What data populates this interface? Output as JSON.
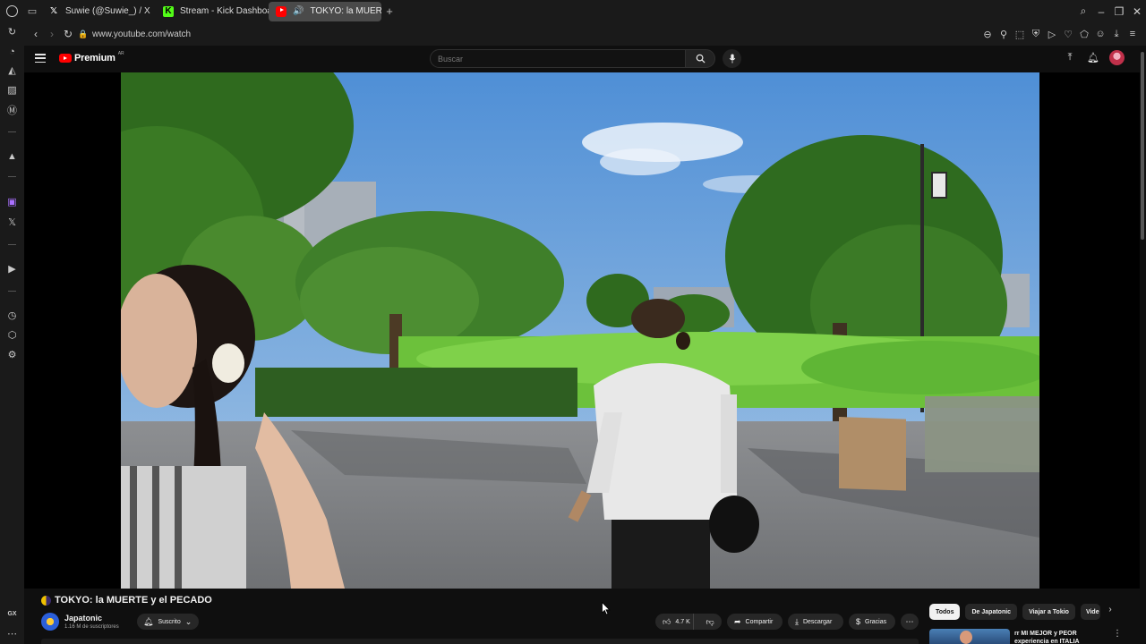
{
  "browser": {
    "tabs": [
      {
        "title": "Suwie (@Suwie_) / X",
        "icon": "x-logo-icon",
        "active": false
      },
      {
        "title": "Stream - Kick Dashboard",
        "icon": "kick-logo-icon",
        "active": false
      },
      {
        "title": "TOKYO: la MUERTE",
        "icon": "youtube-logo-icon",
        "active": true,
        "audio": true
      }
    ],
    "url": "www.youtube.com/watch",
    "sidebar_bottom_label": "GX"
  },
  "youtube": {
    "logo_text": "Premium",
    "logo_superscript": "AR",
    "search_placeholder": "Buscar",
    "accent": "#ff0000"
  },
  "video": {
    "title_emoji": "🌓",
    "title": "TOKYO: la MUERTE y el PECADO",
    "channel_name": "Japatonic",
    "subscribers": "1.16 M de suscriptores",
    "subscribe_label": "Suscrito",
    "likes": "4.7 K",
    "share_label": "Compartir",
    "download_label": "Descargar",
    "thanks_label": "Gracias"
  },
  "recommendations": {
    "chips": [
      "Todos",
      "De Japatonic",
      "Viajar a Tokio",
      "Vide"
    ],
    "active_chip": "Todos",
    "first_item_title": "rr MI MEJOR y PEOR experiencia en ITALIA"
  }
}
